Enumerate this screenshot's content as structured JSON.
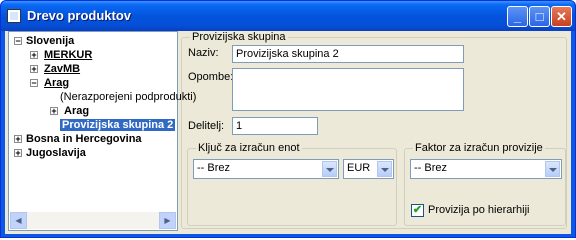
{
  "window": {
    "title": "Drevo produktov",
    "minimize": "_",
    "maximize": "□",
    "close": "✕"
  },
  "tree": {
    "items": [
      {
        "label": "Slovenija",
        "toggle": "−"
      },
      {
        "label": "MERKUR",
        "toggle": "+"
      },
      {
        "label": "ZavMB",
        "toggle": "+"
      },
      {
        "label": "Arag",
        "toggle": "−"
      },
      {
        "label": "(Nerazporejeni podprodukti)"
      },
      {
        "label": "Arag",
        "toggle": "+"
      },
      {
        "label": "Provizijska skupina 2"
      },
      {
        "label": "Bosna in Hercegovina",
        "toggle": "+"
      },
      {
        "label": "Jugoslavija",
        "toggle": "+"
      }
    ],
    "scroll_left": "◀",
    "scroll_right": "▶"
  },
  "form": {
    "group_title": "Provizijska skupina",
    "naziv_label": "Naziv:",
    "naziv_value": "Provizijska skupina 2",
    "opombe_label": "Opombe:",
    "opombe_value": "",
    "delitelj_label": "Delitelj:",
    "delitelj_value": "1",
    "kljuc_group_title": "Ključ za izračun enot",
    "kljuc_value": "-- Brez",
    "currency_value": "EUR",
    "faktor_group_title": "Faktor za izračun provizije",
    "faktor_value": "-- Brez",
    "provizija_checkbox_label": "Provizija po hierarhiji",
    "provizija_checked": true,
    "check_mark": "✔"
  }
}
